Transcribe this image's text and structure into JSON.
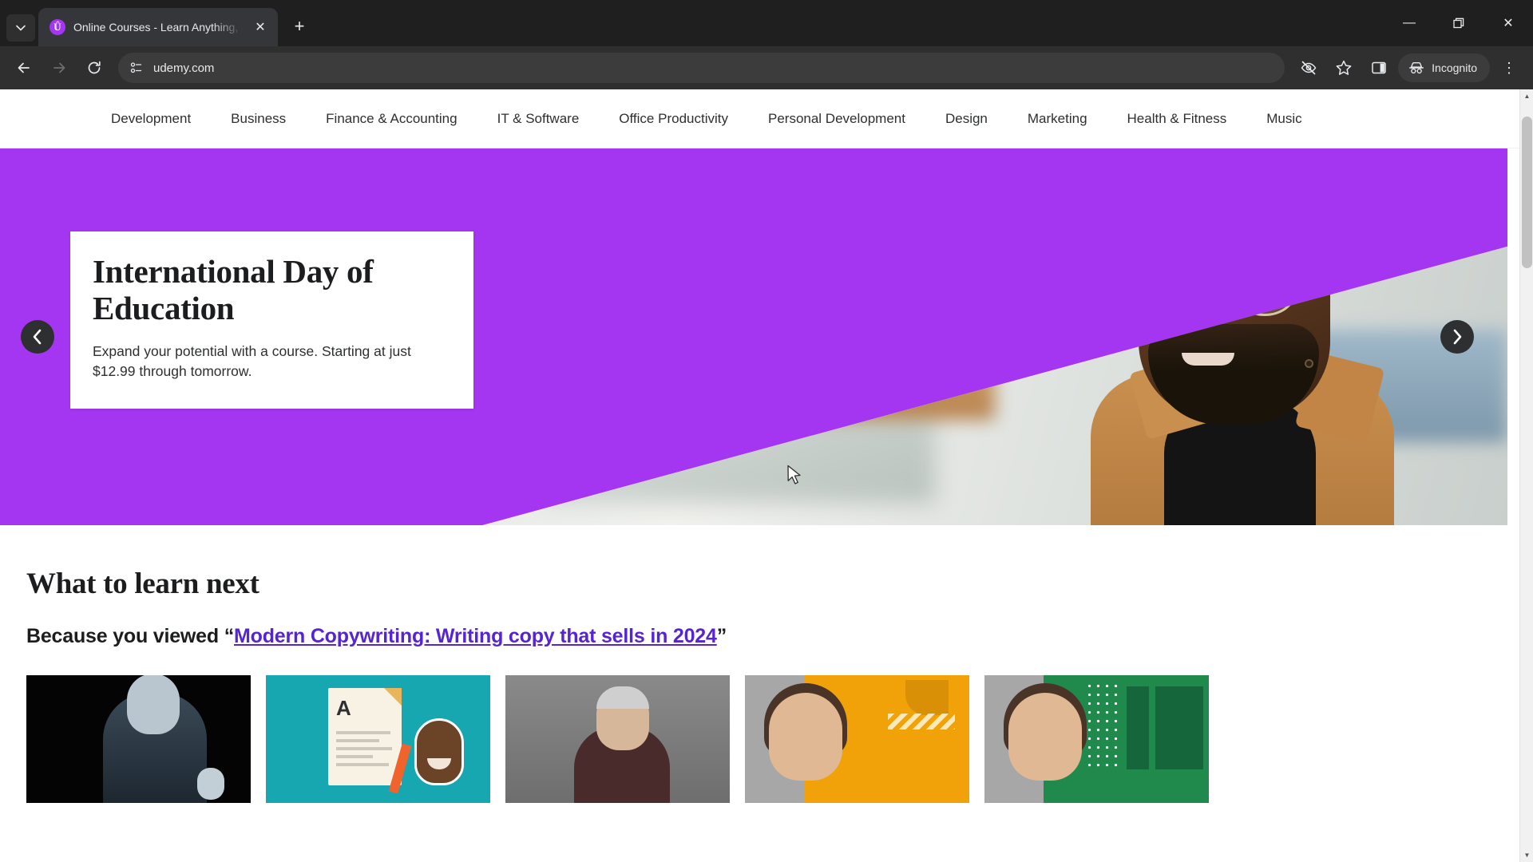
{
  "browser": {
    "tab_list_icon": "chevron-down-icon",
    "tab": {
      "title": "Online Courses - Learn Anything, On Your Schedule",
      "favicon_letter": "Û",
      "close_label": "✕"
    },
    "new_tab_label": "+",
    "window_controls": {
      "minimize": "—",
      "maximize": "❐",
      "close": "✕"
    },
    "toolbar": {
      "back": "←",
      "forward": "→",
      "reload": "↻",
      "site_info_icon": "page-info-icon",
      "url": "udemy.com",
      "tracking_protection_icon": "eye-slash-icon",
      "bookmark_icon": "star-icon",
      "side_panel_icon": "side-panel-icon",
      "incognito_label": "Incognito",
      "menu_icon": "⋮"
    }
  },
  "catnav": {
    "items": [
      {
        "label": "Development"
      },
      {
        "label": "Business"
      },
      {
        "label": "Finance & Accounting"
      },
      {
        "label": "IT & Software"
      },
      {
        "label": "Office Productivity"
      },
      {
        "label": "Personal Development"
      },
      {
        "label": "Design"
      },
      {
        "label": "Marketing"
      },
      {
        "label": "Health & Fitness"
      },
      {
        "label": "Music"
      }
    ]
  },
  "hero": {
    "background_color": "#a435f0",
    "title": "International Day of Education",
    "subtitle": "Expand your potential with a course. Starting at just $12.99 through tomorrow.",
    "prev_label": "‹",
    "next_label": "›"
  },
  "sections": {
    "what_to_learn_next": "What to learn next",
    "because_prefix": "Because you viewed “",
    "because_link": "Modern Copywriting: Writing copy that sells in 2024",
    "because_suffix": "”",
    "link_color": "#5624d0"
  },
  "cards": [
    {
      "name": "card-1",
      "thumb_letter": ""
    },
    {
      "name": "card-2",
      "thumb_letter": "A"
    },
    {
      "name": "card-3",
      "thumb_letter": ""
    },
    {
      "name": "card-4",
      "thumb_letter": ""
    },
    {
      "name": "card-5",
      "thumb_letter": ""
    }
  ],
  "scrollbar": {
    "up_label": "▲",
    "down_label": "▼"
  }
}
